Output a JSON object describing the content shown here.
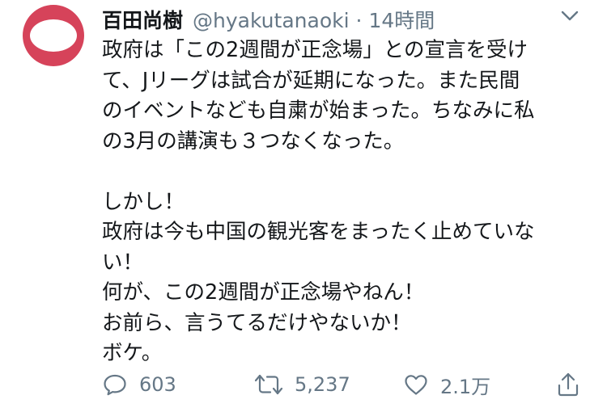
{
  "user": {
    "display_name": "百田尚樹",
    "handle": "@hyakutanaoki",
    "separator": "·",
    "time": "14時間",
    "avatar_color": "#d6435a"
  },
  "tweet": {
    "text": "政府は「この2週間が正念場」との宣言を受け\nて、Jリーグは試合が延期になった。また民間\nのイベントなども自粛が始まった。ちなみに私\nの3月の講演も３つなくなった。\n\nしかし！\n政府は今も中国の観光客をまったく止めていな\nい！\n何が、この2週間が正念場やねん！\nお前ら、言うてるだけやないか！\nボケ。"
  },
  "actions": {
    "reply_count": "603",
    "retweet_count": "5,237",
    "like_count": "2.1万",
    "icons": [
      "reply-icon",
      "retweet-icon",
      "like-icon",
      "share-icon"
    ]
  },
  "colors": {
    "text": "#14171a",
    "secondary": "#657786"
  }
}
